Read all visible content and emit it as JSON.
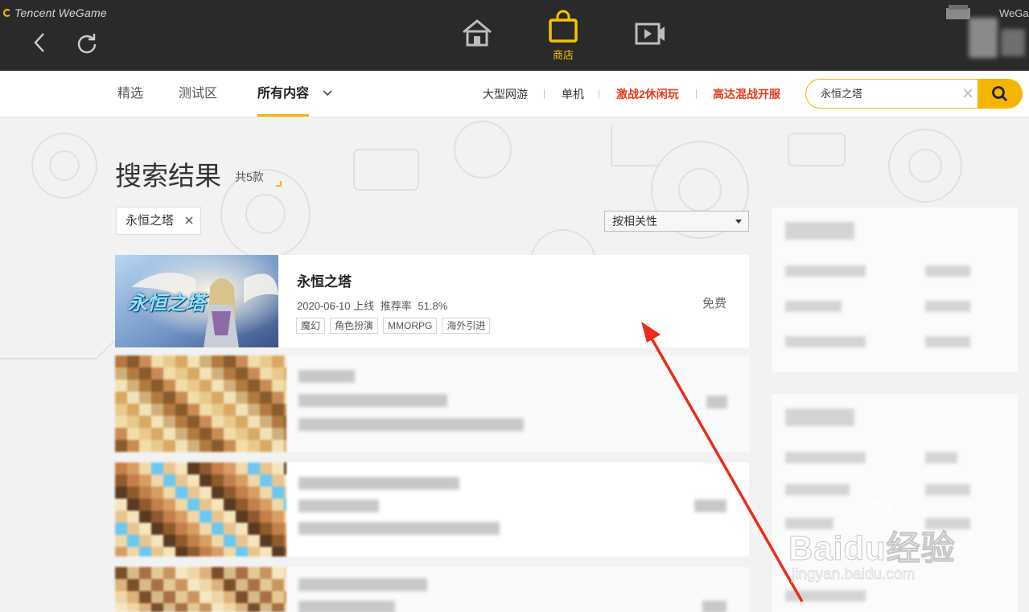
{
  "brand": "Tencent WeGame",
  "topbar": {
    "store_label": "商店",
    "right_text": "WeGa"
  },
  "subnav": {
    "tabs": [
      "精选",
      "测试区",
      "所有内容"
    ],
    "links": [
      "大型网游",
      "单机",
      "激战2休闲玩",
      "高达混战开服"
    ]
  },
  "search": {
    "query": "永恒之塔"
  },
  "results": {
    "title": "搜索结果",
    "count": "共5款",
    "filter_chip": "永恒之塔",
    "sort": "按相关性"
  },
  "game": {
    "name": "永恒之塔",
    "release": "2020-06-10 上线",
    "rating_label": "推荐率",
    "rating": "51.8%",
    "tags": [
      "魔幻",
      "角色扮演",
      "MMORPG",
      "海外引进"
    ],
    "price": "免费",
    "thumb_text": "永恒之塔"
  },
  "watermark": {
    "brand": "Baidu经验",
    "url": "jingyan.baidu.com"
  },
  "colors": {
    "accent": "#f5b400",
    "hot_link": "#e23b1b",
    "topbar": "#2a2a2a",
    "arrow": "#ee2a1c"
  }
}
